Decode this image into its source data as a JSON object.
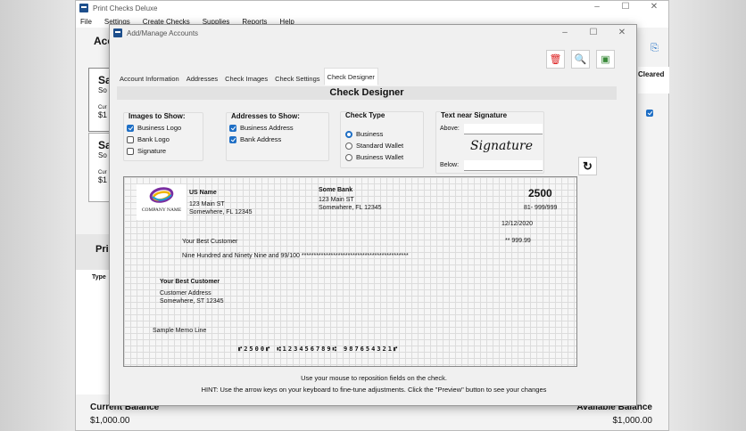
{
  "main_window": {
    "title": "Print Checks Deluxe",
    "menu": [
      "File",
      "Settings",
      "Create Checks",
      "Supplies",
      "Reports",
      "Help"
    ],
    "accounts_header": "Acc",
    "cards": [
      {
        "title": "Sa",
        "sub": "So",
        "label": "Cur",
        "value": "$1"
      },
      {
        "title": "Sa",
        "sub": "So",
        "label": "Cur",
        "value": "$1"
      }
    ],
    "print_header": "Pri",
    "type_col": "Type",
    "cleared_col": "Cleared",
    "current_balance_label": "Current Balance",
    "current_balance": "$1,000.00",
    "available_balance_label": "Available Balance",
    "available_balance": "$1,000.00"
  },
  "dialog": {
    "title": "Add/Manage Accounts",
    "tabs": [
      "Account Information",
      "Addresses",
      "Check Images",
      "Check Settings",
      "Check Designer"
    ],
    "heading": "Check Designer",
    "images": {
      "title": "Images to Show:",
      "items": [
        {
          "label": "Business Logo",
          "checked": true
        },
        {
          "label": "Bank Logo",
          "checked": false
        },
        {
          "label": "Signature",
          "checked": false
        }
      ]
    },
    "addresses": {
      "title": "Addresses to Show:",
      "items": [
        {
          "label": "Business Address",
          "checked": true
        },
        {
          "label": "Bank Address",
          "checked": true
        }
      ]
    },
    "check_type": {
      "title": "Check Type",
      "options": [
        "Business",
        "Standard Wallet",
        "Business Wallet"
      ],
      "selected": "Business"
    },
    "signature": {
      "title": "Text near Signature",
      "above_label": "Above:",
      "below_label": "Below:",
      "above_value": "",
      "below_value": "",
      "sample": "Signature"
    },
    "check": {
      "logo_text": "COMPANY NAME",
      "name": "US Name",
      "addr1": "123 Main ST",
      "addr2": "Somewhere, FL 12345",
      "bank": "Some Bank",
      "bank_addr1": "123 Main ST",
      "bank_addr2": "Somewhere, FL 12345",
      "number": "2500",
      "routing_frac": "81- 999/999",
      "date": "12/12/2020",
      "payee": "Your Best Customer",
      "amount": "** 999.99",
      "amount_words": "Nine Hundred and Ninety Nine and 99/100 ********************************************",
      "addr_name": "Your Best Customer",
      "addr_line1": "Customer Address",
      "addr_line2": "Somewhere, ST 12345",
      "memo": "Sample Memo Line",
      "micr": "⑈2500⑈ ⑆123456789⑆ 987654321⑈"
    },
    "hint1": "Use your mouse to reposition fields on the check.",
    "hint2": "HINT: Use the arrow keys on your keyboard to fine-tune adjustments. Click the \"Preview\" button to see your changes"
  }
}
